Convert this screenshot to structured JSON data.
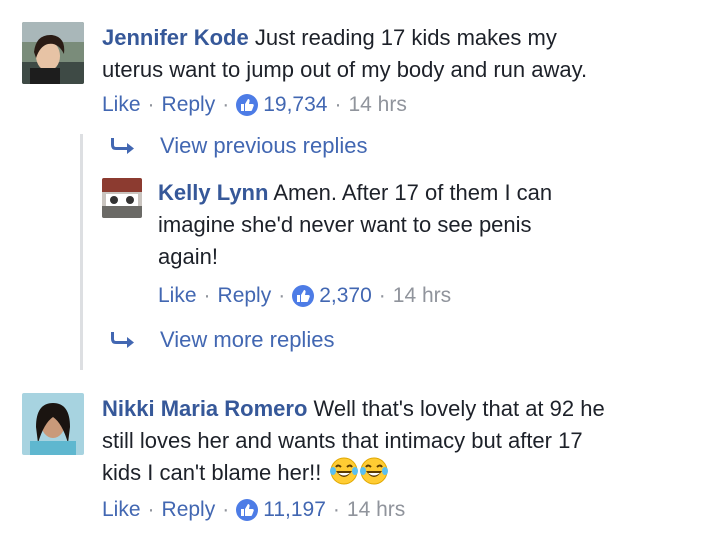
{
  "comments": [
    {
      "author": "Jennifer Kode",
      "text_line1": "Just reading 17 kids makes my",
      "text_line2": "uterus want to jump out of my body and run away.",
      "like_label": "Like",
      "reply_label": "Reply",
      "reaction_count": "19,734",
      "time": "14 hrs"
    },
    {
      "author": "Kelly Lynn",
      "text_line1": "Amen. After 17 of them I can",
      "text_line2": "imagine she'd never want to see penis",
      "text_line3": "again!",
      "like_label": "Like",
      "reply_label": "Reply",
      "reaction_count": "2,370",
      "time": "14 hrs"
    },
    {
      "author": "Nikki Maria Romero",
      "text_line1": "Well that's lovely that at 92 he",
      "text_line2": "still loves her and wants that intimacy but after 17",
      "text_line3": "kids I can't blame her!!",
      "like_label": "Like",
      "reply_label": "Reply",
      "reaction_count": "11,197",
      "time": "14 hrs"
    }
  ],
  "thread": {
    "view_previous": "View previous replies",
    "view_more": "View more replies"
  },
  "separator": "·",
  "icons": {
    "reaction": "thumbs-up-icon",
    "reply_arrow": "reply-arrow-icon",
    "emoji": "laughing-tears-emoji"
  },
  "colors": {
    "name": "#365899",
    "link": "#4267b2",
    "meta": "#90949c",
    "like_badge": "#4d7ce6"
  }
}
